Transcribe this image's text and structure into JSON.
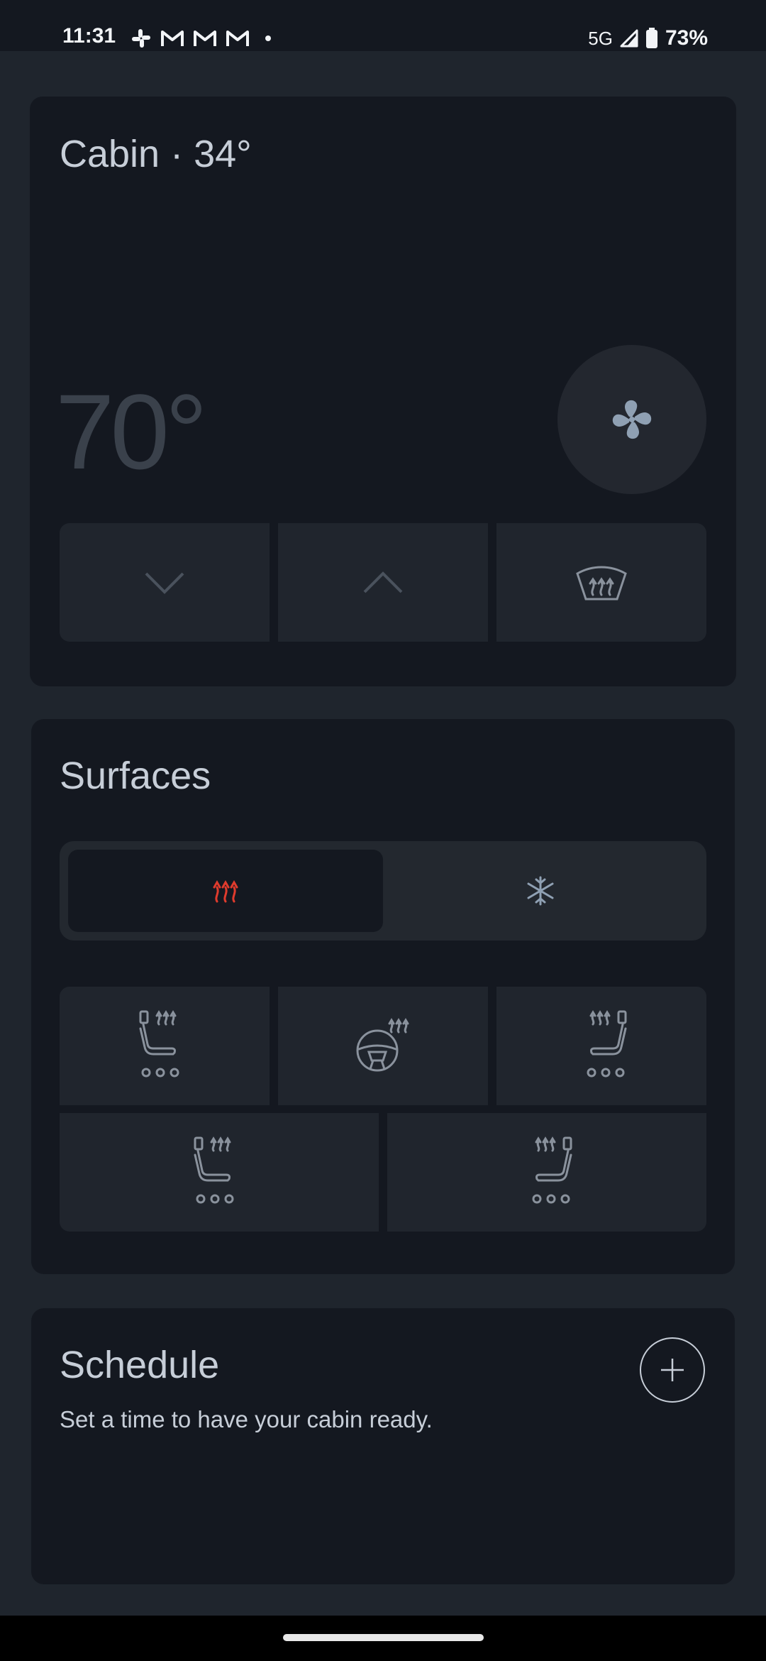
{
  "status_bar": {
    "time": "11:31",
    "notification_icons": [
      "slack-icon",
      "gmail-icon",
      "gmail-icon",
      "gmail-icon"
    ],
    "network": "5G",
    "battery": "73%"
  },
  "cabin": {
    "title": "Cabin · 34°",
    "set_temperature": "70°",
    "buttons": [
      "temperature-down",
      "temperature-up",
      "front-defrost"
    ]
  },
  "surfaces": {
    "title": "Surfaces",
    "mode_options": [
      "heat",
      "cool"
    ],
    "selected_mode": "heat",
    "heat_color": "#e03b2d",
    "items": [
      "driver-seat-heater",
      "steering-wheel-heater",
      "passenger-seat-heater",
      "rear-left-seat-heater",
      "rear-right-seat-heater"
    ]
  },
  "schedule": {
    "title": "Schedule",
    "subtitle": "Set a time to have your cabin ready."
  },
  "colors": {
    "background": "#1f252d",
    "card": "#141820",
    "cell": "#20252d",
    "icon": "#8a929d"
  }
}
